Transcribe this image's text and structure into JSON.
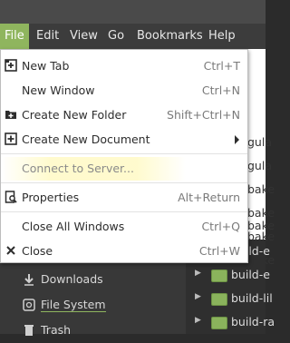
{
  "menubar": {
    "items": [
      {
        "label": "File"
      },
      {
        "label": "Edit"
      },
      {
        "label": "View"
      },
      {
        "label": "Go"
      },
      {
        "label": "Bookmarks"
      },
      {
        "label": "Help"
      }
    ]
  },
  "file_menu": {
    "items": [
      {
        "label": "New Tab",
        "shortcut": "Ctrl+T",
        "icon": "new-tab-icon"
      },
      {
        "label": "New Window",
        "shortcut": "Ctrl+N"
      },
      {
        "label": "Create New Folder",
        "shortcut": "Shift+Ctrl+N",
        "icon": "new-folder-icon"
      },
      {
        "label": "Create New Document",
        "icon": "new-document-icon",
        "submenu": true
      },
      {
        "label": "Connect to Server...",
        "disabled": true
      },
      {
        "label": "Properties",
        "shortcut": "Alt+Return",
        "icon": "properties-icon"
      },
      {
        "label": "Close All Windows",
        "shortcut": "Ctrl+Q"
      },
      {
        "label": "Close",
        "shortcut": "Ctrl+W",
        "icon": "close-icon"
      }
    ]
  },
  "sidebar": {
    "items": [
      {
        "label": "Downloads",
        "icon": "download-icon"
      },
      {
        "label": "File System",
        "icon": "drive-icon",
        "selected": true
      },
      {
        "label": "Trash",
        "icon": "trash-icon"
      }
    ]
  },
  "listing": {
    "rows": [
      {
        "name": "gula"
      },
      {
        "name": "gula"
      },
      {
        "name": "bake"
      },
      {
        "name": "bake"
      },
      {
        "name": "bake"
      },
      {
        "name": "bake"
      },
      {
        "name": "bake"
      },
      {
        "name": "build-e"
      },
      {
        "name": "build-e"
      },
      {
        "name": "build-lil"
      },
      {
        "name": "build-ra"
      }
    ]
  },
  "colors": {
    "accent": "#8fb55e",
    "menubar_bg": "#3c3c3c",
    "menu_bg": "#ffffff"
  }
}
